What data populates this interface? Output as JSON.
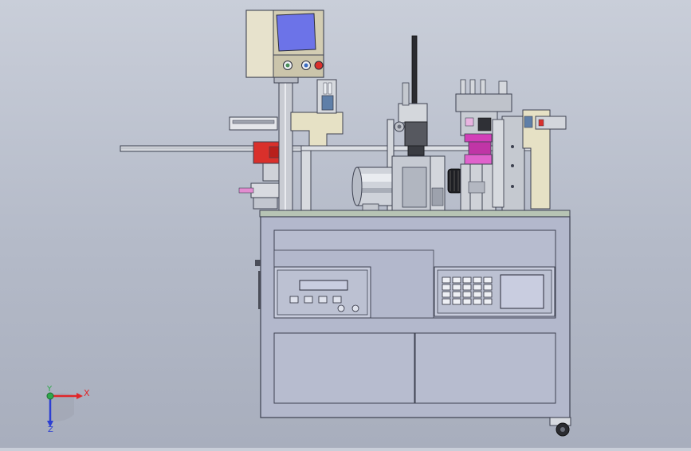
{
  "viewport": {
    "background_top": "#c9ced9",
    "background_bottom": "#a8aebd"
  },
  "colors": {
    "cabinet_fill": "#b3b8cc",
    "cabinet_line": "#3d4150",
    "hmi_housing": "#dcd6bd",
    "hmi_screen": "#6c73e8",
    "accent_red": "#d9302b",
    "magenta_part": "#d23fb8",
    "steel": "#c6cad3",
    "dark": "#1e1f24",
    "axis_x": "#e0262a",
    "axis_y": "#2ea84a",
    "axis_z": "#2c3fd2"
  },
  "axes": {
    "x_label": "X",
    "y_label": "Y",
    "z_label": "Z"
  },
  "control_panel": {
    "buttons": [
      "start-button",
      "stop-button",
      "emergency-stop-button"
    ]
  }
}
